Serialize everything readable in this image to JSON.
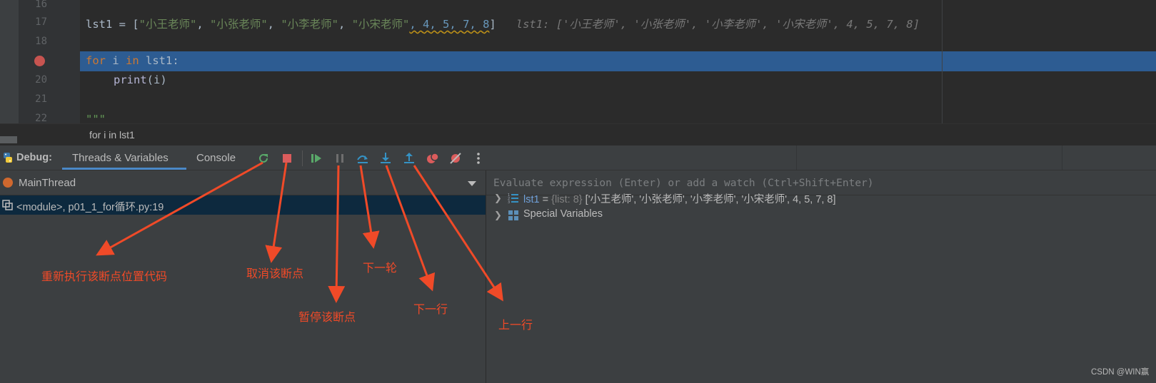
{
  "editor": {
    "line_numbers": [
      "16",
      "17",
      "18",
      "20",
      "21",
      "22"
    ],
    "line17": {
      "var": "lst1",
      "op": " = [",
      "s1": "\"小王老师\"",
      "s2": "\"小张老师\"",
      "s3": "\"小李老师\"",
      "s4": "\"小宋老师\"",
      "n1": "4",
      "n2": "5",
      "n3": "7",
      "n4": "8",
      "sep": ", ",
      "close": "]",
      "inlay": "lst1: ['小王老师', '小张老师', '小李老师', '小宋老师', 4, 5, 7, 8]"
    },
    "line19": {
      "kw_for": "for",
      "var_i": " i ",
      "kw_in": "in",
      "rest": " lst1:"
    },
    "line20": {
      "fn": "print",
      "args": "(i)"
    },
    "line22": "\"\"\"",
    "breadcrumb": "for i in lst1"
  },
  "debug": {
    "title": "Debug:",
    "tabs": [
      "Threads & Variables",
      "Console"
    ],
    "thread": "MainThread",
    "frame": "<module>, p01_1_for循环.py:19",
    "watch_placeholder": "Evaluate expression (Enter) or add a watch (Ctrl+Shift+Enter)",
    "variables": [
      {
        "name": "lst1",
        "eq": " = ",
        "type": "{list: 8}",
        "value": " ['小王老师', '小张老师', '小李老师', '小宋老师', 4, 5, 7, 8]"
      },
      {
        "name": "Special Variables"
      }
    ]
  },
  "icons": {
    "rerun": "rerun-icon",
    "stop": "stop-icon",
    "resume": "resume-icon",
    "pause": "pause-icon",
    "step_over": "step-over-icon",
    "step_into": "step-into-icon",
    "step_out": "step-out-icon",
    "view_breakpoints": "view-breakpoints-icon",
    "mute_breakpoints": "mute-breakpoints-icon",
    "more": "more-icon"
  },
  "annotations": {
    "rerun": "重新执行该断点位置代码",
    "stop": "取消该断点",
    "pause": "暂停该断点",
    "step_over": "下一轮",
    "step_into": "下一行",
    "step_out": "上一行"
  },
  "watermark": "CSDN @WIN赢",
  "colors": {
    "editor_bg": "#2b2b2b",
    "panel_bg": "#3c3f41",
    "highlight": "#2d5c92",
    "breakpoint": "#c75450",
    "annotation": "#f04a28"
  }
}
